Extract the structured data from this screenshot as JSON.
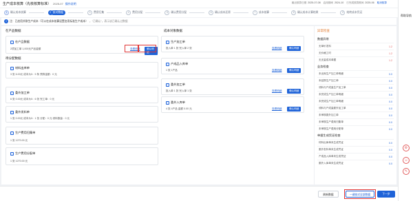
{
  "topbar": {
    "title": "生产成本核算（先核核算标准）",
    "period": "2025-07",
    "link": "操作说明",
    "meta": [
      {
        "label": "最近核算日期",
        "value": "2025-07-08"
      },
      {
        "label": "启用期间",
        "value": "2024-10"
      },
      {
        "label": "已完成核算期间",
        "value": "2025-06"
      },
      {
        "label": "",
        "value": "取消核算",
        "blue": true
      }
    ]
  },
  "rail": {
    "label": "帮助导航"
  },
  "steps": [
    {
      "num": "1",
      "label": "确认成本核算",
      "state": "done"
    },
    {
      "num": "2",
      "label": "核对数据",
      "state": "active"
    },
    {
      "num": "3",
      "label": "费用归集",
      "state": "todo"
    },
    {
      "num": "4",
      "label": "费用分配",
      "state": "todo"
    },
    {
      "num": "5",
      "label": "确认费用分配",
      "state": "todo"
    },
    {
      "num": "6",
      "label": "确认成本还原",
      "state": "todo"
    },
    {
      "num": "7",
      "label": "成本核算",
      "state": "todo"
    },
    {
      "num": "8",
      "label": "确认成本计算结果",
      "state": "todo"
    },
    {
      "num": "9",
      "label": "结转成本凭证",
      "state": "todo"
    }
  ],
  "notice": {
    "text": "注：已启用关联生产成本（可以在成本核算设置启用标准生产成本）",
    "tail": "，“已确认”，表示该已确认过数据",
    "hl": "先核算标准"
  },
  "left": {
    "heading": "在产品数据",
    "card1": {
      "title": "在产品数据",
      "value": "2项加工单 1,000元产品金额",
      "view": "查看明细",
      "confirm": "确认明细"
    },
    "sub_heading": "待分配数据",
    "cards": [
      {
        "title": "材料出库单",
        "line": "3 张  6.00元  成本为0：5 条  预算金额：0 元"
      },
      {
        "title": "委外加工单",
        "line": "6 张  0.00元  成本为0：6 张  完工单：0 元"
      },
      {
        "title": "委外发料单",
        "line": "1 张  0.00元  成本为0：1 张  分配：0 元  领料数量：0 元"
      },
      {
        "title": "生产费用归集单",
        "line": "1 张  1270.00 元"
      },
      {
        "title": "生产费用分配单",
        "line": "1 张  1270.00 元"
      }
    ],
    "view": "查看明细",
    "confirm": "确认明细"
  },
  "middle": {
    "heading": "成本对象数据",
    "cards": [
      {
        "title": "生产加工单",
        "line": "投入单 1 张  完入单 2 张"
      },
      {
        "title": "产成品入库单",
        "line": "1 张  1产品"
      },
      {
        "title": "委外加工单",
        "line": "投入单 1 张  完入单 1 张"
      },
      {
        "title": "委外入库单",
        "line": "4 张  4产品  金额 0.00 元"
      }
    ],
    "view": "查看明细",
    "confirm": "确认明细"
  },
  "panel": {
    "title": "异常检查",
    "sections": [
      {
        "heading": "数据异常",
        "rows": [
          {
            "label": "无单价发料",
            "status": "1.2",
            "red": true
          },
          {
            "label": "无价格工时",
            "status": "1.2",
            "red": true
          },
          {
            "label": "无无量成本单据",
            "status": "1.2",
            "red": true
          }
        ]
      },
      {
        "heading": "业务检查",
        "rows": [
          {
            "label": "未出库生产加工单明细",
            "status": "0.0"
          },
          {
            "label": "未结算生产加工单",
            "status": "0.0"
          },
          {
            "label": "领料与产成量生产加工单",
            "status": "0.0"
          },
          {
            "label": "未完成生产加工单明细",
            "status": "0.0"
          },
          {
            "label": "未完成生产加工单明细",
            "status": "0.0"
          },
          {
            "label": "领料与产成量委外加工单",
            "status": "0.0"
          },
          {
            "label": "未审核委外加工单",
            "status": "0.0"
          },
          {
            "label": "未审核生产费用归集单",
            "status": "0.0"
          },
          {
            "label": "未审核生产费用分配单",
            "status": "0.0"
          }
        ]
      },
      {
        "heading": "单据生成凭证检查",
        "rows": [
          {
            "label": "材料出库单未生成凭证",
            "status": "0.0"
          },
          {
            "label": "委外发料单未生成凭证",
            "status": "0.0"
          },
          {
            "label": "产成品入库单未生成凭证",
            "status": "0.0"
          },
          {
            "label": "委外入库单未生成凭证",
            "status": "0.0"
          }
        ]
      }
    ]
  },
  "bottom": {
    "refresh": "刷新数据",
    "batch": "一键核对全部数据",
    "next": "下一步"
  },
  "colors": {
    "accent": "#1f63d8",
    "warn": "#e0782d",
    "error": "#e03434"
  }
}
